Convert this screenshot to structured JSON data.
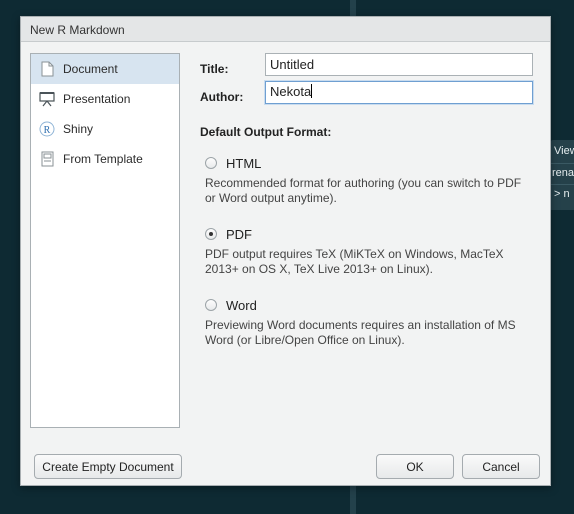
{
  "background": {
    "panel_lines": [
      "View",
      "rename",
      "> n"
    ]
  },
  "dialog": {
    "title": "New R Markdown",
    "sidebar": {
      "items": [
        {
          "label": "Document",
          "icon": "document-icon",
          "selected": true
        },
        {
          "label": "Presentation",
          "icon": "presentation-icon",
          "selected": false
        },
        {
          "label": "Shiny",
          "icon": "shiny-icon",
          "selected": false
        },
        {
          "label": "From Template",
          "icon": "template-icon",
          "selected": false
        }
      ]
    },
    "form": {
      "title_label": "Title:",
      "title_value": "Untitled",
      "author_label": "Author:",
      "author_value": "Nekota"
    },
    "output": {
      "section_title": "Default Output Format:",
      "options": [
        {
          "label": "HTML",
          "checked": false,
          "description": "Recommended format for authoring (you can switch to PDF or Word output anytime)."
        },
        {
          "label": "PDF",
          "checked": true,
          "description": "PDF output requires TeX (MiKTeX on Windows, MacTeX 2013+ on OS X, TeX Live 2013+ on Linux)."
        },
        {
          "label": "Word",
          "checked": false,
          "description": "Previewing Word documents requires an installation of MS Word (or Libre/Open Office on Linux)."
        }
      ]
    },
    "buttons": {
      "create_empty": "Create Empty Document",
      "ok": "OK",
      "cancel": "Cancel"
    }
  }
}
